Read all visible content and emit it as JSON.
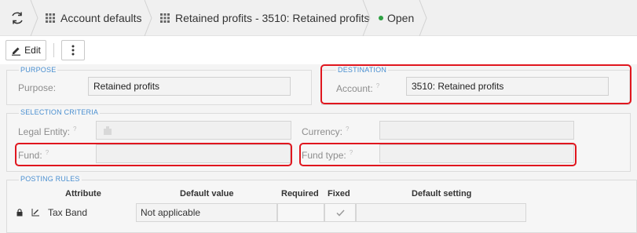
{
  "breadcrumb": {
    "items": [
      {
        "label": "Account defaults",
        "icon": "grid-icon"
      },
      {
        "label": "Retained profits - 3510: Retained profits",
        "icon": "grid-icon"
      }
    ],
    "status": "Open",
    "status_color": "#2ea043"
  },
  "toolbar": {
    "edit_label": "Edit",
    "more_icon": "more-vertical-icon"
  },
  "purpose": {
    "legend": "PURPOSE",
    "label": "Purpose:",
    "value": "Retained profits"
  },
  "destination": {
    "legend": "DESTINATION",
    "label": "Account:",
    "value": "3510: Retained profits"
  },
  "selection": {
    "legend": "SELECTION CRITERIA",
    "legal_entity_label": "Legal Entity:",
    "currency_label": "Currency:",
    "fund_label": "Fund:",
    "fund_type_label": "Fund type:"
  },
  "posting_rules": {
    "legend": "POSTING RULES",
    "columns": [
      "Attribute",
      "Default value",
      "Required",
      "Fixed",
      "Default setting"
    ],
    "rows": [
      {
        "attribute": "Tax Band",
        "default_value": "Not applicable",
        "fixed": true
      }
    ]
  },
  "colors": {
    "highlight": "#e0161e",
    "legend_text": "#4a8fd0"
  }
}
